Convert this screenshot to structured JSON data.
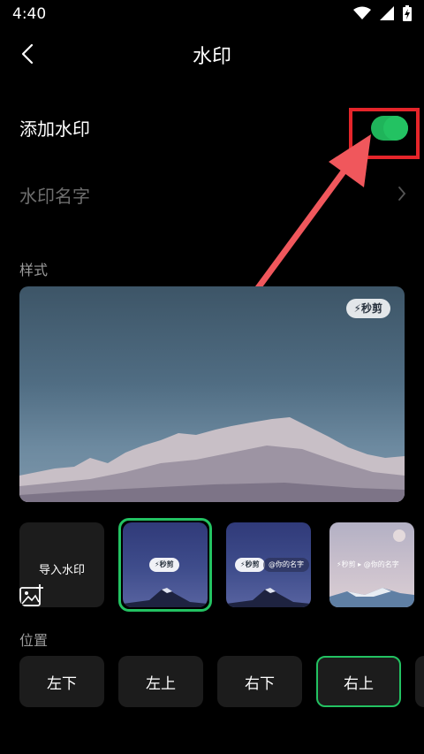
{
  "status": {
    "time": "4:40"
  },
  "header": {
    "title": "水印"
  },
  "settings": {
    "add_watermark_label": "添加水印",
    "add_watermark_enabled": true,
    "watermark_name_label": "水印名字"
  },
  "style": {
    "section_label": "样式",
    "preview_badge": "秒剪",
    "import_label": "导入水印",
    "thumbnails": [
      {
        "badge": "秒剪"
      },
      {
        "badge": "秒剪",
        "extra": "@你的名字"
      },
      {
        "badge": "秒剪",
        "extra": "@你的名字"
      }
    ],
    "selected_index": 0
  },
  "position": {
    "section_label": "位置",
    "options": [
      "左下",
      "左上",
      "右下",
      "右上"
    ],
    "selected": "右上"
  },
  "colors": {
    "accent": "#23c262",
    "annotation": "#e5252a"
  }
}
